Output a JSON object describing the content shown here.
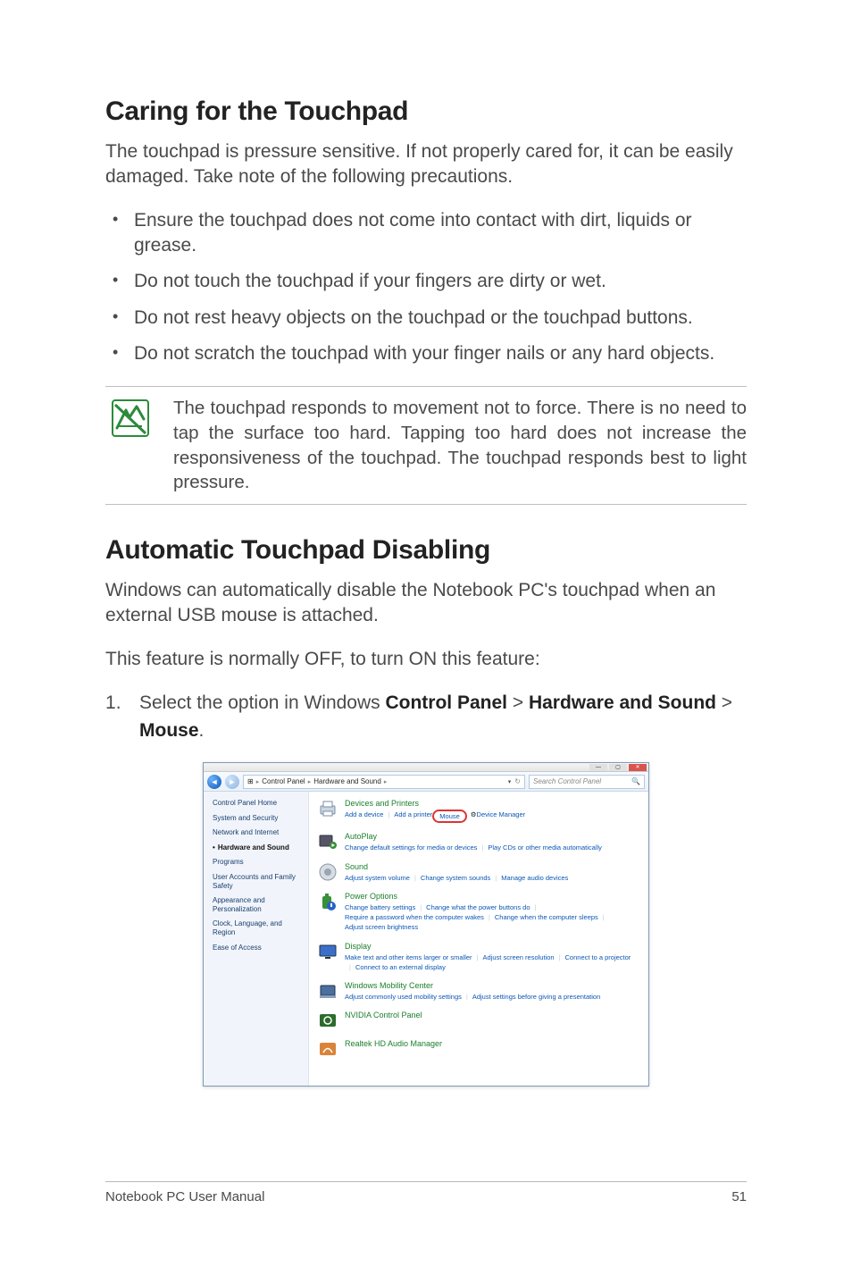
{
  "section1": {
    "title": "Caring for the Touchpad",
    "intro": "The touchpad is pressure sensitive. If not properly cared for, it can be easily damaged. Take note of the following precautions.",
    "bullets": [
      "Ensure the touchpad does not come into contact with dirt, liquids or grease.",
      "Do not touch the touchpad if your fingers are dirty or wet.",
      "Do not rest heavy objects on the touchpad or the touchpad buttons.",
      "Do not scratch the touchpad with your finger nails or any hard objects."
    ],
    "note": "The touchpad responds to movement not to force. There is no need to tap the surface too hard. Tapping too hard does not increase the responsiveness of the touchpad. The touchpad responds best to light pressure."
  },
  "section2": {
    "title": "Automatic Touchpad Disabling",
    "p1": "Windows can automatically disable the Notebook PC's touchpad when an external USB mouse is attached.",
    "p2": "This feature is normally OFF, to turn ON this feature:",
    "step_pre": "Select the option in Windows ",
    "step_b1": "Control Panel",
    "step_gt1": " > ",
    "step_b2": "Hardware and Sound",
    "step_gt2": " > ",
    "step_b3": "Mouse",
    "step_post": "."
  },
  "cp": {
    "breadcrumb": {
      "root_icon": "⊞",
      "seg1": "Control Panel",
      "seg2": "Hardware and Sound"
    },
    "search_placeholder": "Search Control Panel",
    "refresh_icon": "↻",
    "sidebar": [
      "Control Panel Home",
      "System and Security",
      "Network and Internet",
      "Hardware and Sound",
      "Programs",
      "User Accounts and Family Safety",
      "Appearance and Personalization",
      "Clock, Language, and Region",
      "Ease of Access"
    ],
    "cats": {
      "devices": {
        "title": "Devices and Printers",
        "links": [
          "Add a device",
          "Add a printer",
          "Mouse",
          "Device Manager"
        ]
      },
      "autoplay": {
        "title": "AutoPlay",
        "links": [
          "Change default settings for media or devices",
          "Play CDs or other media automatically"
        ]
      },
      "sound": {
        "title": "Sound",
        "links": [
          "Adjust system volume",
          "Change system sounds",
          "Manage audio devices"
        ]
      },
      "power": {
        "title": "Power Options",
        "links": [
          "Change battery settings",
          "Change what the power buttons do",
          "Require a password when the computer wakes",
          "Change when the computer sleeps",
          "Adjust screen brightness"
        ]
      },
      "display": {
        "title": "Display",
        "links": [
          "Make text and other items larger or smaller",
          "Adjust screen resolution",
          "Connect to a projector",
          "Connect to an external display"
        ]
      },
      "mobility": {
        "title": "Windows Mobility Center",
        "links": [
          "Adjust commonly used mobility settings",
          "Adjust settings before giving a presentation"
        ]
      },
      "nvidia": {
        "title": "NVIDIA Control Panel"
      },
      "realtek": {
        "title": "Realtek HD Audio Manager"
      }
    }
  },
  "footer": {
    "left": "Notebook PC User Manual",
    "right": "51"
  }
}
